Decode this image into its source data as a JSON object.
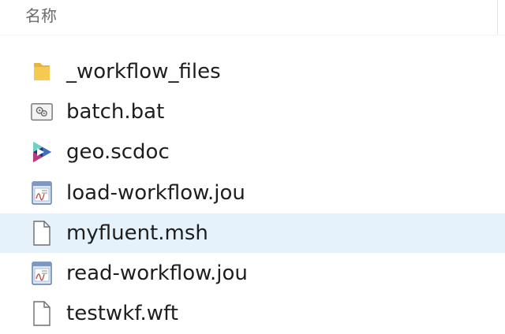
{
  "header": {
    "column_name": "名称"
  },
  "files": [
    {
      "name": "_workflow_files",
      "icon": "folder-icon"
    },
    {
      "name": "batch.bat",
      "icon": "batch-file-icon"
    },
    {
      "name": "geo.scdoc",
      "icon": "spaceclaim-icon"
    },
    {
      "name": "load-workflow.jou",
      "icon": "journal-file-icon"
    },
    {
      "name": "myfluent.msh",
      "icon": "blank-file-icon",
      "selected": true
    },
    {
      "name": "read-workflow.jou",
      "icon": "journal-file-icon"
    },
    {
      "name": "testwkf.wft",
      "icon": "blank-file-icon"
    }
  ],
  "colors": {
    "selected_row": "#e5f1fb",
    "folder": "#f6c951"
  }
}
